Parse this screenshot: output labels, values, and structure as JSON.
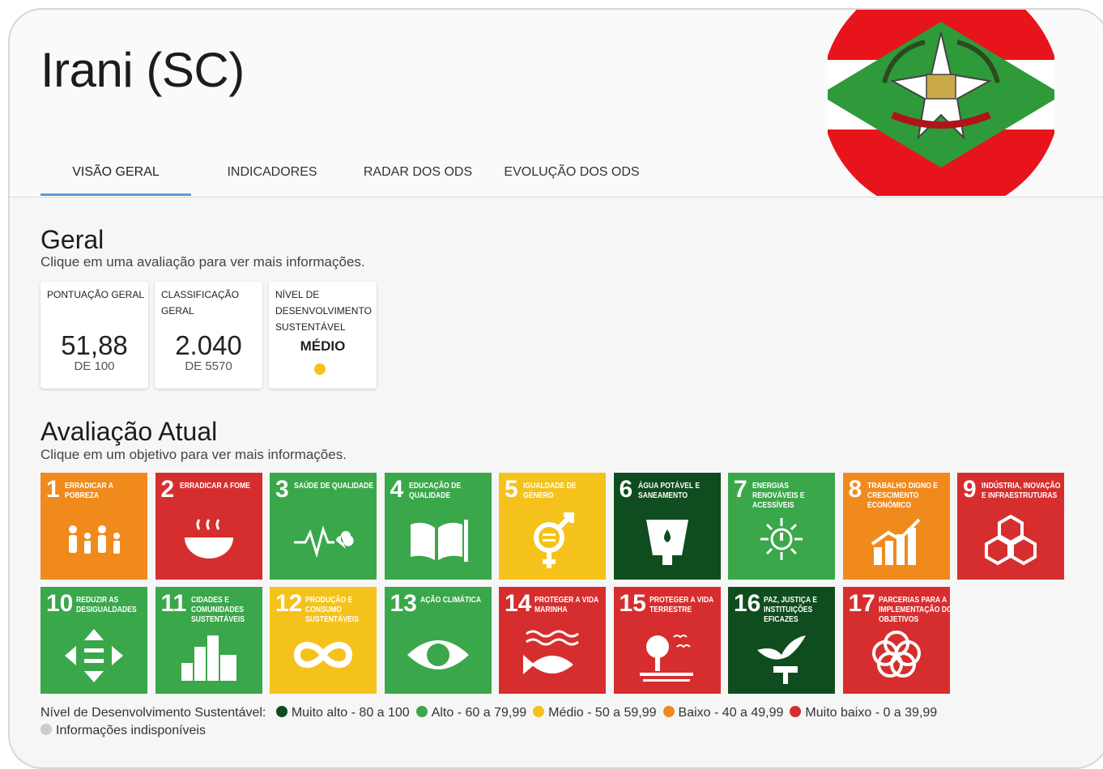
{
  "header": {
    "title": "Irani (SC)",
    "flag_colors": {
      "red": "#e8141b",
      "green": "#2e9a3a",
      "white": "#ffffff"
    }
  },
  "tabs": [
    {
      "label": "VISÃO GERAL",
      "active": true
    },
    {
      "label": "INDICADORES",
      "active": false
    },
    {
      "label": "RADAR DOS ODS",
      "active": false
    },
    {
      "label": "EVOLUÇÃO DOS ODS",
      "active": false
    }
  ],
  "geral": {
    "heading": "Geral",
    "subtitle": "Clique em uma avaliação para ver mais informações.",
    "cards": [
      {
        "label": "PONTUAÇÃO GERAL",
        "value": "51,88",
        "of": "DE 100"
      },
      {
        "label": "CLASSIFICAÇÃO GERAL",
        "value": "2.040",
        "of": "DE 5570"
      },
      {
        "label": "NÍVEL DE DESENVOLVIMENTO SUSTENTÁVEL",
        "value": "MÉDIO",
        "dot_color": "#f5c21b"
      }
    ]
  },
  "avaliacao": {
    "heading": "Avaliação Atual",
    "subtitle": "Clique em um objetivo para ver mais informações.",
    "goals": [
      {
        "num": "1",
        "name": "ERRADICAR A POBREZA",
        "color": "#f08a1c",
        "icon": "family-icon"
      },
      {
        "num": "2",
        "name": "ERRADICAR A FOME",
        "color": "#d62e2e",
        "icon": "bowl-icon"
      },
      {
        "num": "3",
        "name": "SAÚDE DE QUALIDADE",
        "color": "#3aa74a",
        "icon": "heartbeat-icon"
      },
      {
        "num": "4",
        "name": "EDUCAÇÃO DE QUALIDADE",
        "color": "#3aa74a",
        "icon": "book-icon"
      },
      {
        "num": "5",
        "name": "IGUALDADE DE GÉNERO",
        "color": "#f5c21b",
        "icon": "gender-icon"
      },
      {
        "num": "6",
        "name": "ÁGUA POTÁVEL E SANEAMENTO",
        "color": "#0f4d1e",
        "icon": "water-icon"
      },
      {
        "num": "7",
        "name": "ENERGIAS RENOVÁVEIS E ACESSÍVEIS",
        "color": "#3aa74a",
        "icon": "sun-power-icon"
      },
      {
        "num": "8",
        "name": "TRABALHO DIGNO E CRESCIMENTO ECONÓMICO",
        "color": "#f08a1c",
        "icon": "growth-chart-icon"
      },
      {
        "num": "9",
        "name": "INDÚSTRIA, INOVAÇÃO E INFRAESTRUTURAS",
        "color": "#d62e2e",
        "icon": "cubes-icon"
      },
      {
        "num": "10",
        "name": "REDUZIR AS DESIGUALDADES",
        "color": "#3aa74a",
        "icon": "equality-arrows-icon"
      },
      {
        "num": "11",
        "name": "CIDADES E COMUNIDADES SUSTENTÁVEIS",
        "color": "#3aa74a",
        "icon": "city-icon"
      },
      {
        "num": "12",
        "name": "PRODUÇÃO E CONSUMO SUSTENTÁVEIS",
        "color": "#f5c21b",
        "icon": "infinity-icon"
      },
      {
        "num": "13",
        "name": "AÇÃO CLIMÁTICA",
        "color": "#3aa74a",
        "icon": "eye-earth-icon"
      },
      {
        "num": "14",
        "name": "PROTEGER A VIDA MARINHA",
        "color": "#d62e2e",
        "icon": "fish-icon"
      },
      {
        "num": "15",
        "name": "PROTEGER A VIDA TERRESTRE",
        "color": "#d62e2e",
        "icon": "tree-icon"
      },
      {
        "num": "16",
        "name": "PAZ, JUSTIÇA E INSTITUIÇÕES EFICAZES",
        "color": "#0f4d1e",
        "icon": "dove-gavel-icon"
      },
      {
        "num": "17",
        "name": "PARCERIAS PARA A IMPLEMENTAÇÃO DOS OBJETIVOS",
        "color": "#d62e2e",
        "icon": "rings-icon"
      }
    ]
  },
  "legend": {
    "prefix": "Nível de Desenvolvimento Sustentável:",
    "items": [
      {
        "label": "Muito alto - 80 a 100",
        "color": "#0f4d1e"
      },
      {
        "label": "Alto - 60 a 79,99",
        "color": "#3aa74a"
      },
      {
        "label": "Médio - 50 a 59,99",
        "color": "#f5c21b"
      },
      {
        "label": "Baixo - 40 a 49,99",
        "color": "#f08a1c"
      },
      {
        "label": "Muito baixo - 0 a 39,99",
        "color": "#d62e2e"
      },
      {
        "label": "Informações indisponíveis",
        "color": "#cccccc"
      }
    ]
  }
}
